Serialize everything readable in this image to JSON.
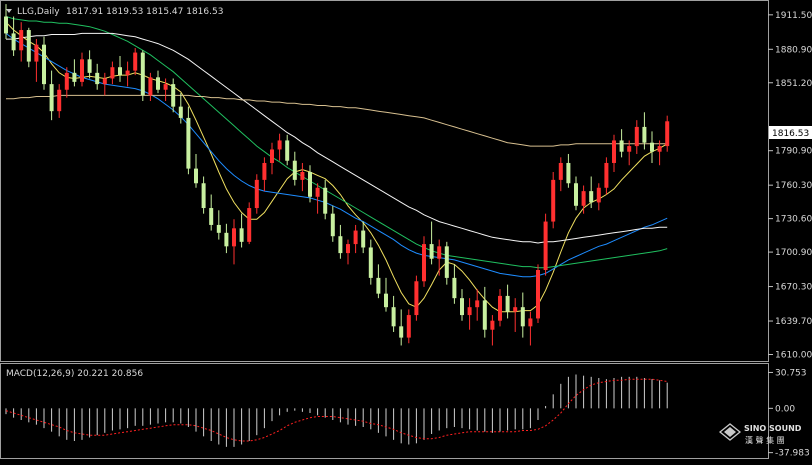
{
  "chart_data": {
    "type": "candlestick",
    "header": {
      "symbol_label": "LLG,Daily",
      "ohlc_text": "1817.91 1819.53 1815.47 1816.53"
    },
    "price_axis": {
      "ticks": [
        "1911.50",
        "1880.90",
        "1851.20",
        "1790.90",
        "1760.30",
        "1730.60",
        "1700.90",
        "1670.30",
        "1639.70",
        "1610.00"
      ],
      "tick_values": [
        1911.5,
        1880.9,
        1851.2,
        1790.9,
        1760.3,
        1730.6,
        1700.9,
        1670.3,
        1639.7,
        1610.0
      ],
      "range": [
        1606,
        1922
      ],
      "current_price_label": "1816.53",
      "current_price": 1816.53
    },
    "candles": [
      [
        1910,
        1921,
        1890,
        1895
      ],
      [
        1895,
        1910,
        1875,
        1880
      ],
      [
        1880,
        1905,
        1870,
        1898
      ],
      [
        1898,
        1900,
        1865,
        1870
      ],
      [
        1870,
        1890,
        1852,
        1885
      ],
      [
        1885,
        1892,
        1845,
        1850
      ],
      [
        1850,
        1862,
        1818,
        1826
      ],
      [
        1826,
        1850,
        1820,
        1845
      ],
      [
        1845,
        1865,
        1838,
        1860
      ],
      [
        1860,
        1872,
        1848,
        1852
      ],
      [
        1852,
        1878,
        1848,
        1872
      ],
      [
        1872,
        1880,
        1855,
        1860
      ],
      [
        1860,
        1868,
        1845,
        1850
      ],
      [
        1850,
        1860,
        1840,
        1855
      ],
      [
        1855,
        1870,
        1850,
        1865
      ],
      [
        1865,
        1875,
        1852,
        1858
      ],
      [
        1858,
        1870,
        1848,
        1862
      ],
      [
        1862,
        1882,
        1858,
        1878
      ],
      [
        1878,
        1880,
        1835,
        1840
      ],
      [
        1840,
        1860,
        1835,
        1856
      ],
      [
        1856,
        1862,
        1842,
        1845
      ],
      [
        1845,
        1855,
        1835,
        1850
      ],
      [
        1850,
        1855,
        1825,
        1830
      ],
      [
        1830,
        1842,
        1815,
        1820
      ],
      [
        1820,
        1830,
        1770,
        1775
      ],
      [
        1775,
        1788,
        1758,
        1762
      ],
      [
        1762,
        1768,
        1735,
        1740
      ],
      [
        1740,
        1752,
        1720,
        1725
      ],
      [
        1725,
        1738,
        1712,
        1718
      ],
      [
        1718,
        1726,
        1700,
        1706
      ],
      [
        1706,
        1730,
        1690,
        1722
      ],
      [
        1722,
        1735,
        1705,
        1710
      ],
      [
        1710,
        1745,
        1708,
        1740
      ],
      [
        1740,
        1770,
        1735,
        1765
      ],
      [
        1765,
        1785,
        1755,
        1780
      ],
      [
        1780,
        1798,
        1770,
        1792
      ],
      [
        1792,
        1806,
        1782,
        1800
      ],
      [
        1800,
        1805,
        1778,
        1782
      ],
      [
        1782,
        1790,
        1760,
        1765
      ],
      [
        1765,
        1780,
        1755,
        1772
      ],
      [
        1772,
        1778,
        1745,
        1750
      ],
      [
        1750,
        1762,
        1735,
        1758
      ],
      [
        1758,
        1765,
        1730,
        1735
      ],
      [
        1735,
        1742,
        1710,
        1715
      ],
      [
        1715,
        1725,
        1695,
        1700
      ],
      [
        1700,
        1712,
        1690,
        1708
      ],
      [
        1708,
        1725,
        1700,
        1720
      ],
      [
        1720,
        1728,
        1700,
        1705
      ],
      [
        1705,
        1712,
        1672,
        1678
      ],
      [
        1678,
        1690,
        1660,
        1664
      ],
      [
        1664,
        1678,
        1648,
        1652
      ],
      [
        1652,
        1662,
        1630,
        1635
      ],
      [
        1635,
        1650,
        1618,
        1625
      ],
      [
        1625,
        1650,
        1620,
        1645
      ],
      [
        1645,
        1680,
        1640,
        1675
      ],
      [
        1675,
        1715,
        1670,
        1708
      ],
      [
        1708,
        1728,
        1690,
        1695
      ],
      [
        1695,
        1712,
        1680,
        1706
      ],
      [
        1706,
        1710,
        1672,
        1678
      ],
      [
        1678,
        1690,
        1655,
        1660
      ],
      [
        1660,
        1668,
        1640,
        1645
      ],
      [
        1645,
        1660,
        1632,
        1652
      ],
      [
        1652,
        1668,
        1640,
        1658
      ],
      [
        1658,
        1670,
        1625,
        1632
      ],
      [
        1632,
        1645,
        1618,
        1640
      ],
      [
        1640,
        1668,
        1635,
        1662
      ],
      [
        1662,
        1672,
        1642,
        1648
      ],
      [
        1648,
        1660,
        1630,
        1652
      ],
      [
        1652,
        1665,
        1625,
        1635
      ],
      [
        1635,
        1648,
        1618,
        1642
      ],
      [
        1642,
        1690,
        1638,
        1685
      ],
      [
        1685,
        1735,
        1680,
        1728
      ],
      [
        1728,
        1772,
        1722,
        1765
      ],
      [
        1765,
        1785,
        1755,
        1780
      ],
      [
        1780,
        1788,
        1758,
        1762
      ],
      [
        1762,
        1768,
        1738,
        1742
      ],
      [
        1742,
        1760,
        1735,
        1755
      ],
      [
        1755,
        1768,
        1740,
        1745
      ],
      [
        1745,
        1762,
        1738,
        1758
      ],
      [
        1758,
        1785,
        1752,
        1780
      ],
      [
        1780,
        1805,
        1772,
        1800
      ],
      [
        1800,
        1810,
        1785,
        1790
      ],
      [
        1790,
        1800,
        1778,
        1795
      ],
      [
        1795,
        1818,
        1788,
        1812
      ],
      [
        1812,
        1825,
        1792,
        1798
      ],
      [
        1798,
        1808,
        1780,
        1790
      ],
      [
        1790,
        1800,
        1778,
        1795
      ],
      [
        1795,
        1822,
        1790,
        1817
      ]
    ],
    "moving_averages": [
      {
        "color": "#f0e060",
        "values": [
          1905,
          1898,
          1893,
          1888,
          1884,
          1878,
          1868,
          1860,
          1856,
          1855,
          1856,
          1857,
          1856,
          1855,
          1857,
          1858,
          1858,
          1860,
          1858,
          1855,
          1853,
          1851,
          1848,
          1843,
          1832,
          1818,
          1803,
          1788,
          1772,
          1757,
          1745,
          1736,
          1730,
          1730,
          1736,
          1746,
          1756,
          1766,
          1772,
          1774,
          1772,
          1769,
          1766,
          1760,
          1752,
          1742,
          1734,
          1727,
          1718,
          1707,
          1694,
          1679,
          1665,
          1655,
          1652,
          1660,
          1672,
          1685,
          1692,
          1690,
          1684,
          1676,
          1667,
          1659,
          1652,
          1648,
          1648,
          1648,
          1649,
          1649,
          1654,
          1667,
          1683,
          1701,
          1718,
          1731,
          1740,
          1745,
          1748,
          1752,
          1757,
          1765,
          1772,
          1779,
          1786,
          1790,
          1793,
          1797
        ]
      },
      {
        "color": "#1e8cff",
        "values": [
          1895,
          1890,
          1886,
          1882,
          1878,
          1874,
          1870,
          1866,
          1862,
          1859,
          1856,
          1854,
          1852,
          1850,
          1849,
          1848,
          1847,
          1846,
          1844,
          1841,
          1837,
          1832,
          1827,
          1821,
          1814,
          1806,
          1798,
          1790,
          1782,
          1775,
          1769,
          1764,
          1760,
          1757,
          1755,
          1754,
          1753,
          1752,
          1751,
          1750,
          1749,
          1747,
          1745,
          1742,
          1739,
          1735,
          1731,
          1728,
          1724,
          1720,
          1716,
          1712,
          1707,
          1703,
          1700,
          1698,
          1697,
          1696,
          1695,
          1694,
          1692,
          1690,
          1688,
          1686,
          1684,
          1682,
          1681,
          1680,
          1679,
          1679,
          1680,
          1682,
          1686,
          1690,
          1694,
          1697,
          1700,
          1703,
          1706,
          1708,
          1711,
          1714,
          1717,
          1720,
          1723,
          1725,
          1728,
          1731
        ]
      },
      {
        "color": "#20c060",
        "values": [
          1910,
          1908,
          1907,
          1906,
          1906,
          1905,
          1905,
          1904,
          1904,
          1903,
          1902,
          1901,
          1899,
          1897,
          1894,
          1891,
          1888,
          1884,
          1880,
          1876,
          1871,
          1866,
          1861,
          1855,
          1849,
          1843,
          1837,
          1831,
          1825,
          1819,
          1813,
          1807,
          1801,
          1795,
          1790,
          1785,
          1781,
          1776,
          1772,
          1768,
          1764,
          1760,
          1756,
          1752,
          1748,
          1744,
          1740,
          1736,
          1732,
          1728,
          1724,
          1720,
          1716,
          1712,
          1708,
          1705,
          1702,
          1700,
          1698,
          1697,
          1696,
          1695,
          1694,
          1693,
          1692,
          1691,
          1690,
          1689,
          1688,
          1688,
          1687,
          1687,
          1688,
          1689,
          1690,
          1691,
          1692,
          1693,
          1694,
          1695,
          1696,
          1697,
          1698,
          1699,
          1700,
          1701,
          1702,
          1704
        ]
      },
      {
        "color": "#f5f5f5",
        "values": [
          1890,
          1890,
          1891,
          1892,
          1893,
          1893,
          1894,
          1894,
          1894,
          1894,
          1895,
          1895,
          1895,
          1895,
          1895,
          1894,
          1893,
          1892,
          1890,
          1888,
          1886,
          1883,
          1880,
          1876,
          1872,
          1867,
          1862,
          1857,
          1852,
          1847,
          1842,
          1837,
          1832,
          1827,
          1822,
          1817,
          1812,
          1807,
          1803,
          1798,
          1794,
          1789,
          1785,
          1781,
          1777,
          1773,
          1769,
          1765,
          1761,
          1757,
          1753,
          1749,
          1745,
          1741,
          1738,
          1734,
          1731,
          1728,
          1726,
          1724,
          1722,
          1720,
          1718,
          1716,
          1714,
          1713,
          1712,
          1711,
          1710,
          1710,
          1709,
          1710,
          1710,
          1711,
          1712,
          1713,
          1714,
          1715,
          1716,
          1717,
          1718,
          1719,
          1720,
          1721,
          1722,
          1722,
          1723,
          1723
        ]
      },
      {
        "color": "#d8c090",
        "values": [
          1837,
          1837,
          1838,
          1838,
          1839,
          1839,
          1839,
          1840,
          1840,
          1840,
          1840,
          1840,
          1840,
          1840,
          1840,
          1840,
          1840,
          1840,
          1840,
          1840,
          1840,
          1840,
          1840,
          1840,
          1840,
          1839,
          1839,
          1838,
          1838,
          1837,
          1837,
          1836,
          1836,
          1835,
          1835,
          1834,
          1834,
          1833,
          1833,
          1832,
          1832,
          1831,
          1831,
          1830,
          1830,
          1829,
          1829,
          1828,
          1827,
          1826,
          1825,
          1824,
          1823,
          1822,
          1821,
          1820,
          1818,
          1816,
          1814,
          1812,
          1810,
          1808,
          1806,
          1804,
          1802,
          1800,
          1798,
          1797,
          1796,
          1795,
          1795,
          1795,
          1795,
          1796,
          1796,
          1797,
          1797,
          1797,
          1797,
          1797,
          1797,
          1797,
          1797,
          1797,
          1797,
          1797,
          1797,
          1797
        ]
      }
    ],
    "macd": {
      "label": "MACD(12,26,9) 20.221 20.856",
      "ticks": [
        "30.753",
        "0.00",
        "-37.983"
      ],
      "tick_values": [
        30.753,
        0.0,
        -37.983
      ],
      "range": [
        -40,
        32
      ],
      "histogram": [
        -5,
        -8,
        -10,
        -12,
        -14,
        -17,
        -20,
        -24,
        -27,
        -28,
        -27,
        -25,
        -23,
        -21,
        -19,
        -18,
        -17,
        -15,
        -15,
        -14,
        -13,
        -12,
        -12,
        -13,
        -16,
        -20,
        -24,
        -28,
        -31,
        -33,
        -33,
        -31,
        -28,
        -23,
        -17,
        -11,
        -6,
        -3,
        -2,
        -3,
        -4,
        -6,
        -8,
        -10,
        -12,
        -14,
        -15,
        -16,
        -18,
        -21,
        -24,
        -27,
        -30,
        -31,
        -30,
        -27,
        -22,
        -19,
        -17,
        -16,
        -17,
        -18,
        -19,
        -20,
        -21,
        -20,
        -19,
        -18,
        -18,
        -17,
        -10,
        2,
        12,
        21,
        27,
        29,
        28,
        27,
        26,
        25,
        26,
        27,
        27,
        27,
        26,
        25,
        24,
        22
      ],
      "signal": [
        -2,
        -4,
        -6,
        -8,
        -10,
        -12,
        -14,
        -16,
        -19,
        -21,
        -22,
        -23,
        -23,
        -23,
        -22,
        -21,
        -20,
        -19,
        -18,
        -17,
        -16,
        -15,
        -14,
        -14,
        -14,
        -15,
        -17,
        -19,
        -22,
        -25,
        -27,
        -28,
        -28,
        -27,
        -25,
        -22,
        -19,
        -15,
        -12,
        -10,
        -8,
        -7,
        -7,
        -7,
        -8,
        -9,
        -10,
        -11,
        -13,
        -14,
        -16,
        -18,
        -21,
        -23,
        -25,
        -26,
        -26,
        -25,
        -23,
        -22,
        -21,
        -20,
        -20,
        -20,
        -20,
        -20,
        -20,
        -20,
        -19,
        -19,
        -18,
        -15,
        -10,
        -4,
        4,
        11,
        16,
        20,
        22,
        23,
        24,
        24,
        25,
        25,
        25,
        25,
        24,
        23
      ]
    }
  },
  "watermark": {
    "brand_line1": "SINO SOUND",
    "brand_line2": "漢 聲 集 團"
  }
}
